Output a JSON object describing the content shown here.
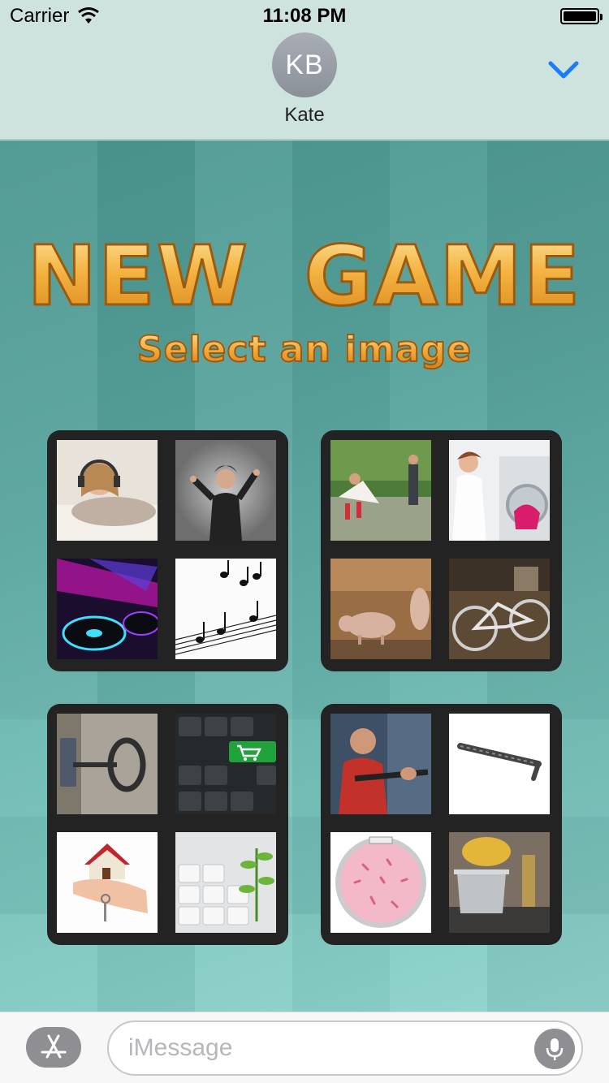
{
  "status_bar": {
    "carrier": "Carrier",
    "time": "11:08 PM"
  },
  "header": {
    "avatar_initials": "KB",
    "contact_name": "Kate"
  },
  "game": {
    "title": "NEW GAME",
    "subtitle": "Select an image",
    "tiles": [
      {
        "images": [
          "woman-headphones",
          "conductor",
          "dj-turntable",
          "sheet-music"
        ]
      },
      {
        "images": [
          "bride-pond",
          "washing-machine",
          "pigs",
          "bicycle"
        ]
      },
      {
        "images": [
          "key-door",
          "keyboard-cart",
          "house-keys",
          "keyboard-plant"
        ]
      },
      {
        "images": [
          "man-pulling",
          "crowbar",
          "petri-dish",
          "cooking-pot"
        ]
      }
    ]
  },
  "input_bar": {
    "placeholder": "iMessage"
  },
  "colors": {
    "accent": "#1a7cf6",
    "title_gold": "#f0a52a"
  }
}
